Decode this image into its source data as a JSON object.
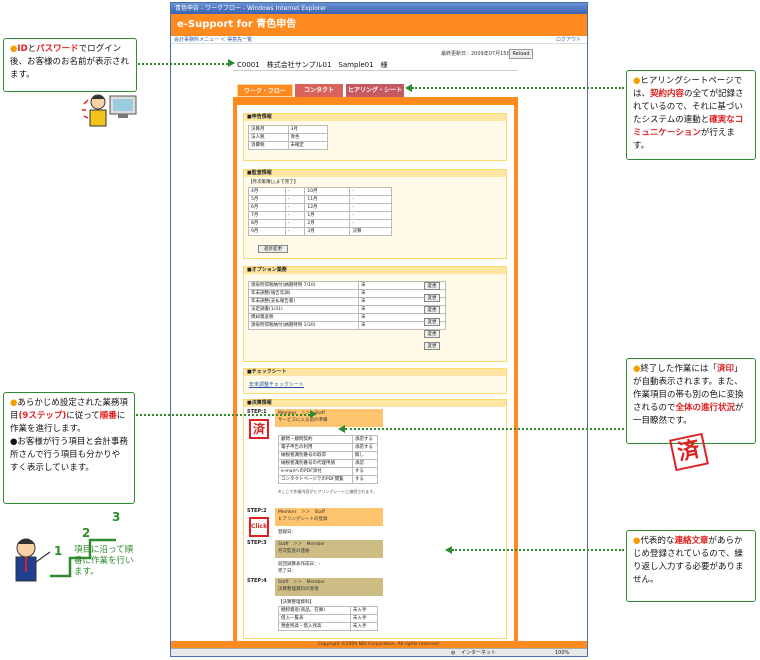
{
  "window_title": "青色申告 - ワークフロー - Windows Internet Explorer",
  "app_title": "e-Support for 青色申告",
  "breadcrumb": "会計事務所メニュー ＜ 得意先一覧",
  "logout": "ログアウト",
  "last_updated": "最終更新日：2009年07月15日",
  "reload": "Reload",
  "client": "C0001　株式会社サンプル01　Sample01　様",
  "tabs": [
    "ワーク・フロー",
    "コンタクト",
    "ヒアリング・シート"
  ],
  "sections": {
    "filing": {
      "title": "■申告情報",
      "rows": [
        [
          "決算月",
          "3月"
        ],
        [
          "法人税",
          "青色"
        ],
        [
          "消費税",
          "未確定"
        ]
      ]
    },
    "monitor": {
      "title": "■監査情報",
      "caption": "【月次帳簿(△まで完了】",
      "rows": [
        [
          "4月",
          "-",
          "10月",
          "-"
        ],
        [
          "5月",
          "-",
          "11月",
          "-"
        ],
        [
          "6月",
          "-",
          "12月",
          "-"
        ],
        [
          "7月",
          "-",
          "1月",
          "-"
        ],
        [
          "8月",
          "-",
          "2月",
          "-"
        ],
        [
          "9月",
          "-",
          "3月",
          "決算"
        ]
      ],
      "button": "進捗変更"
    },
    "options": {
      "title": "■オプション業務",
      "rows": [
        [
          "源泉所得税納付(納期特例 7/10)",
          "未",
          "変更"
        ],
        [
          "年末調整(報告年調)",
          "未",
          "変更"
        ],
        [
          "年末調整(支払報告書)",
          "未",
          "変更"
        ],
        [
          "法定調書(1/31)",
          "未",
          "変更"
        ],
        [
          "償却資産税",
          "未",
          "変更"
        ],
        [
          "源泉所得税納付(納期特例 1/20)",
          "未",
          "変更"
        ]
      ]
    },
    "checksheet": {
      "title": "■チェックシート",
      "link": "年末調整チェックシート"
    },
    "settlement": {
      "title": "■決算情報"
    }
  },
  "steps": [
    {
      "label": "STEP:1",
      "line1": "Member　＞＞　Staff",
      "line2": "サービスに入る前の準備",
      "stamp": "済"
    },
    {
      "label": "STEP:2",
      "line1": "Member　＞＞　Staff",
      "line2": "ヒアリングシートの登録",
      "stamp": "Click",
      "note": "登録日："
    },
    {
      "label": "STEP:3",
      "line1": "Staff　＞＞　Member",
      "line2": "月次監査の連絡",
      "note": "前回試算表作成日：-",
      "note2": "完了日："
    },
    {
      "label": "STEP:4",
      "line1": "Staff　＞＞　Member",
      "line2": "決算整理資料の受領",
      "note": "【決算整理資料】"
    }
  ],
  "step1_items": [
    [
      "顧問・顧問契約",
      "承諾する"
    ],
    [
      "電子申告の利用",
      "承諾する"
    ],
    [
      "納税者識別番号の取得",
      "無し"
    ],
    [
      "納税者識別番号の代理申請",
      "承認"
    ],
    [
      "e-mailへのPDF添付",
      "する"
    ],
    [
      "コンタクトページでのPDF閲覧",
      "する"
    ]
  ],
  "step1_footer": "※ここで作業内容がヒアリングシートに継続されます。",
  "step4_items": [
    [
      "棚卸資産(商品、在庫)",
      "未入手"
    ],
    [
      "借入一覧表",
      "未入手"
    ],
    [
      "預金残高・借入残高",
      "未入手"
    ]
  ],
  "footer": "Copyright ©2009 NDI Corporation. All rights reserved.",
  "status_zone": "インターネット",
  "zoom": "100%",
  "callouts": {
    "login": {
      "prefix": "●",
      "r1": "ID",
      "m1": "と",
      "r2": "パスワード",
      "m2": "でログイン後、お客様のお名前が表示されます。"
    },
    "hearing": {
      "prefix": "●",
      "t1": "ヒアリングシートページでは、",
      "r1": "契約内容",
      "t2": "の全てが記録されているので、それに基づいたシステムの連動と",
      "r2": "確実なコミュニケーション",
      "t3": "が行えます。"
    },
    "stamp": {
      "prefix": "●",
      "t1": "終了した作業には「",
      "r1": "済印",
      "t2": "」が自動表示されます。また、作業項目の帯も別の色に変換されるので",
      "r2": "全体の進行状況",
      "t3": "が一目瞭然です。"
    },
    "steps": {
      "prefix": "●",
      "t1": "あらかじめ設定された業務項目",
      "r1": "(9ステップ)",
      "t2": "に従って",
      "r2": "順番",
      "t3": "に作業を進行します。",
      "t4": "●お客様が行う項目と会計事務所さんで行う項目も分かりやすく表示しています。"
    },
    "template": {
      "prefix": "●",
      "t1": "代表的な",
      "r1": "連絡文章",
      "t2": "があらかじめ登録されているので、繰り返し入力する必要がありません。"
    }
  },
  "stair": {
    "n1": "1",
    "n2": "2",
    "n3": "3",
    "caption": "項目に沿って順番に作業を行います。"
  },
  "stamp_big": "済",
  "colors": {
    "accent": "#ff8a1f",
    "callout_border": "#2e8b2e",
    "highlight_red": "#e02020",
    "bullet": "#f5a000"
  }
}
